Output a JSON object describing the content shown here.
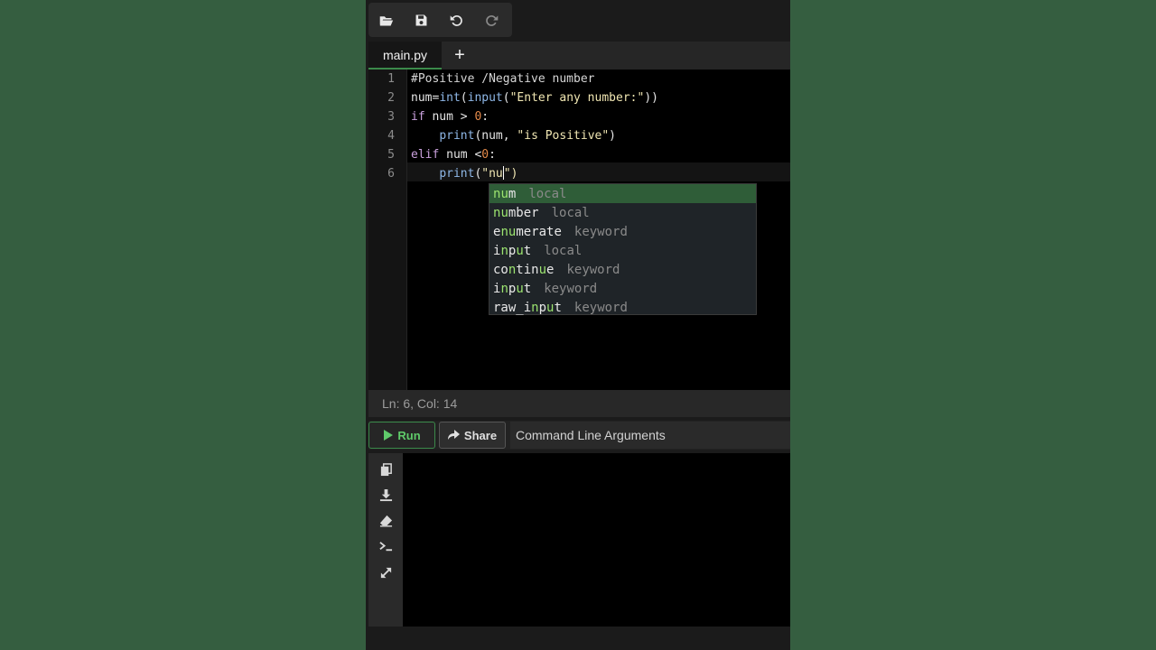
{
  "toolbar": {
    "icons": [
      "folder-open-icon",
      "save-icon",
      "undo-icon",
      "redo-icon"
    ]
  },
  "tabs": {
    "file_name": "main.py",
    "add_label": "+"
  },
  "editor": {
    "line_numbers": [
      "1",
      "2",
      "3",
      "4",
      "5",
      "6"
    ],
    "lines": [
      "#Positive /Negative number",
      "num=int(input(\"Enter any number:\"))",
      "if num > 0:",
      "    print(num, \"is Positive\")",
      "elif num <0:",
      "    print(\"nu\")"
    ],
    "active_line": 6
  },
  "autocomplete": {
    "typed_prefix": "nu",
    "items": [
      {
        "word": "num",
        "kind": "local",
        "selected": true
      },
      {
        "word": "number",
        "kind": "local",
        "selected": false
      },
      {
        "word": "enumerate",
        "kind": "keyword",
        "selected": false
      },
      {
        "word": "input",
        "kind": "local",
        "selected": false
      },
      {
        "word": "continue",
        "kind": "keyword",
        "selected": false
      },
      {
        "word": "input",
        "kind": "keyword",
        "selected": false
      },
      {
        "word": "raw_input",
        "kind": "keyword",
        "selected": false
      }
    ]
  },
  "status": {
    "position": "Ln: 6,  Col: 14"
  },
  "runbar": {
    "run_label": "Run",
    "share_label": "Share",
    "args_label": "Command Line Arguments"
  },
  "console": {
    "side_icons": [
      "copy-icon",
      "download-icon",
      "eraser-icon",
      "terminal-icon",
      "expand-icon"
    ],
    "output": ""
  },
  "colors": {
    "background": "#355e40",
    "accent_green": "#3b8a4a",
    "selected_row": "#2f5d38",
    "match_green": "#9be36f"
  }
}
